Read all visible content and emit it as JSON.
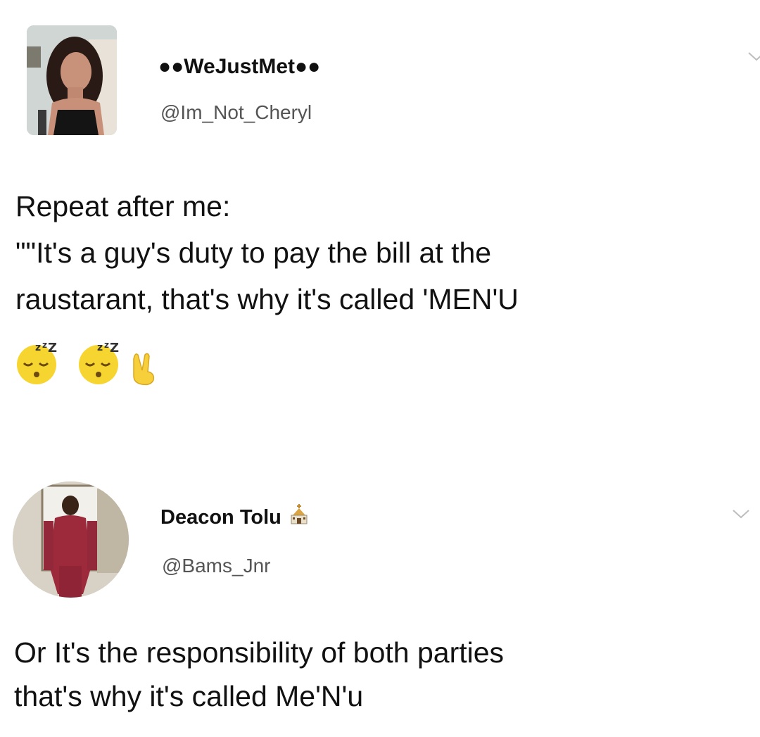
{
  "tweets": [
    {
      "display_name": "●●WeJustMet●●",
      "handle": "@Im_Not_Cheryl",
      "text_lines": [
        "Repeat after me:",
        "\"\"It's a guy's duty to pay the bill at the",
        "raustarant, that's why it's called 'MEN'U"
      ],
      "emoji": [
        "sleeping-face-icon",
        "sleeping-face-icon",
        "victory-hand-icon"
      ]
    },
    {
      "display_name": "Deacon Tolu",
      "name_icon": "church-icon",
      "handle": "@Bams_Jnr",
      "text_lines": [
        "Or It's the responsibility of both parties",
        "that's why it's called Me'N'u"
      ]
    }
  ],
  "colors": {
    "text": "#111111",
    "handle": "#555555",
    "emoji_yellow": "#f7d531",
    "background": "#ffffff"
  }
}
